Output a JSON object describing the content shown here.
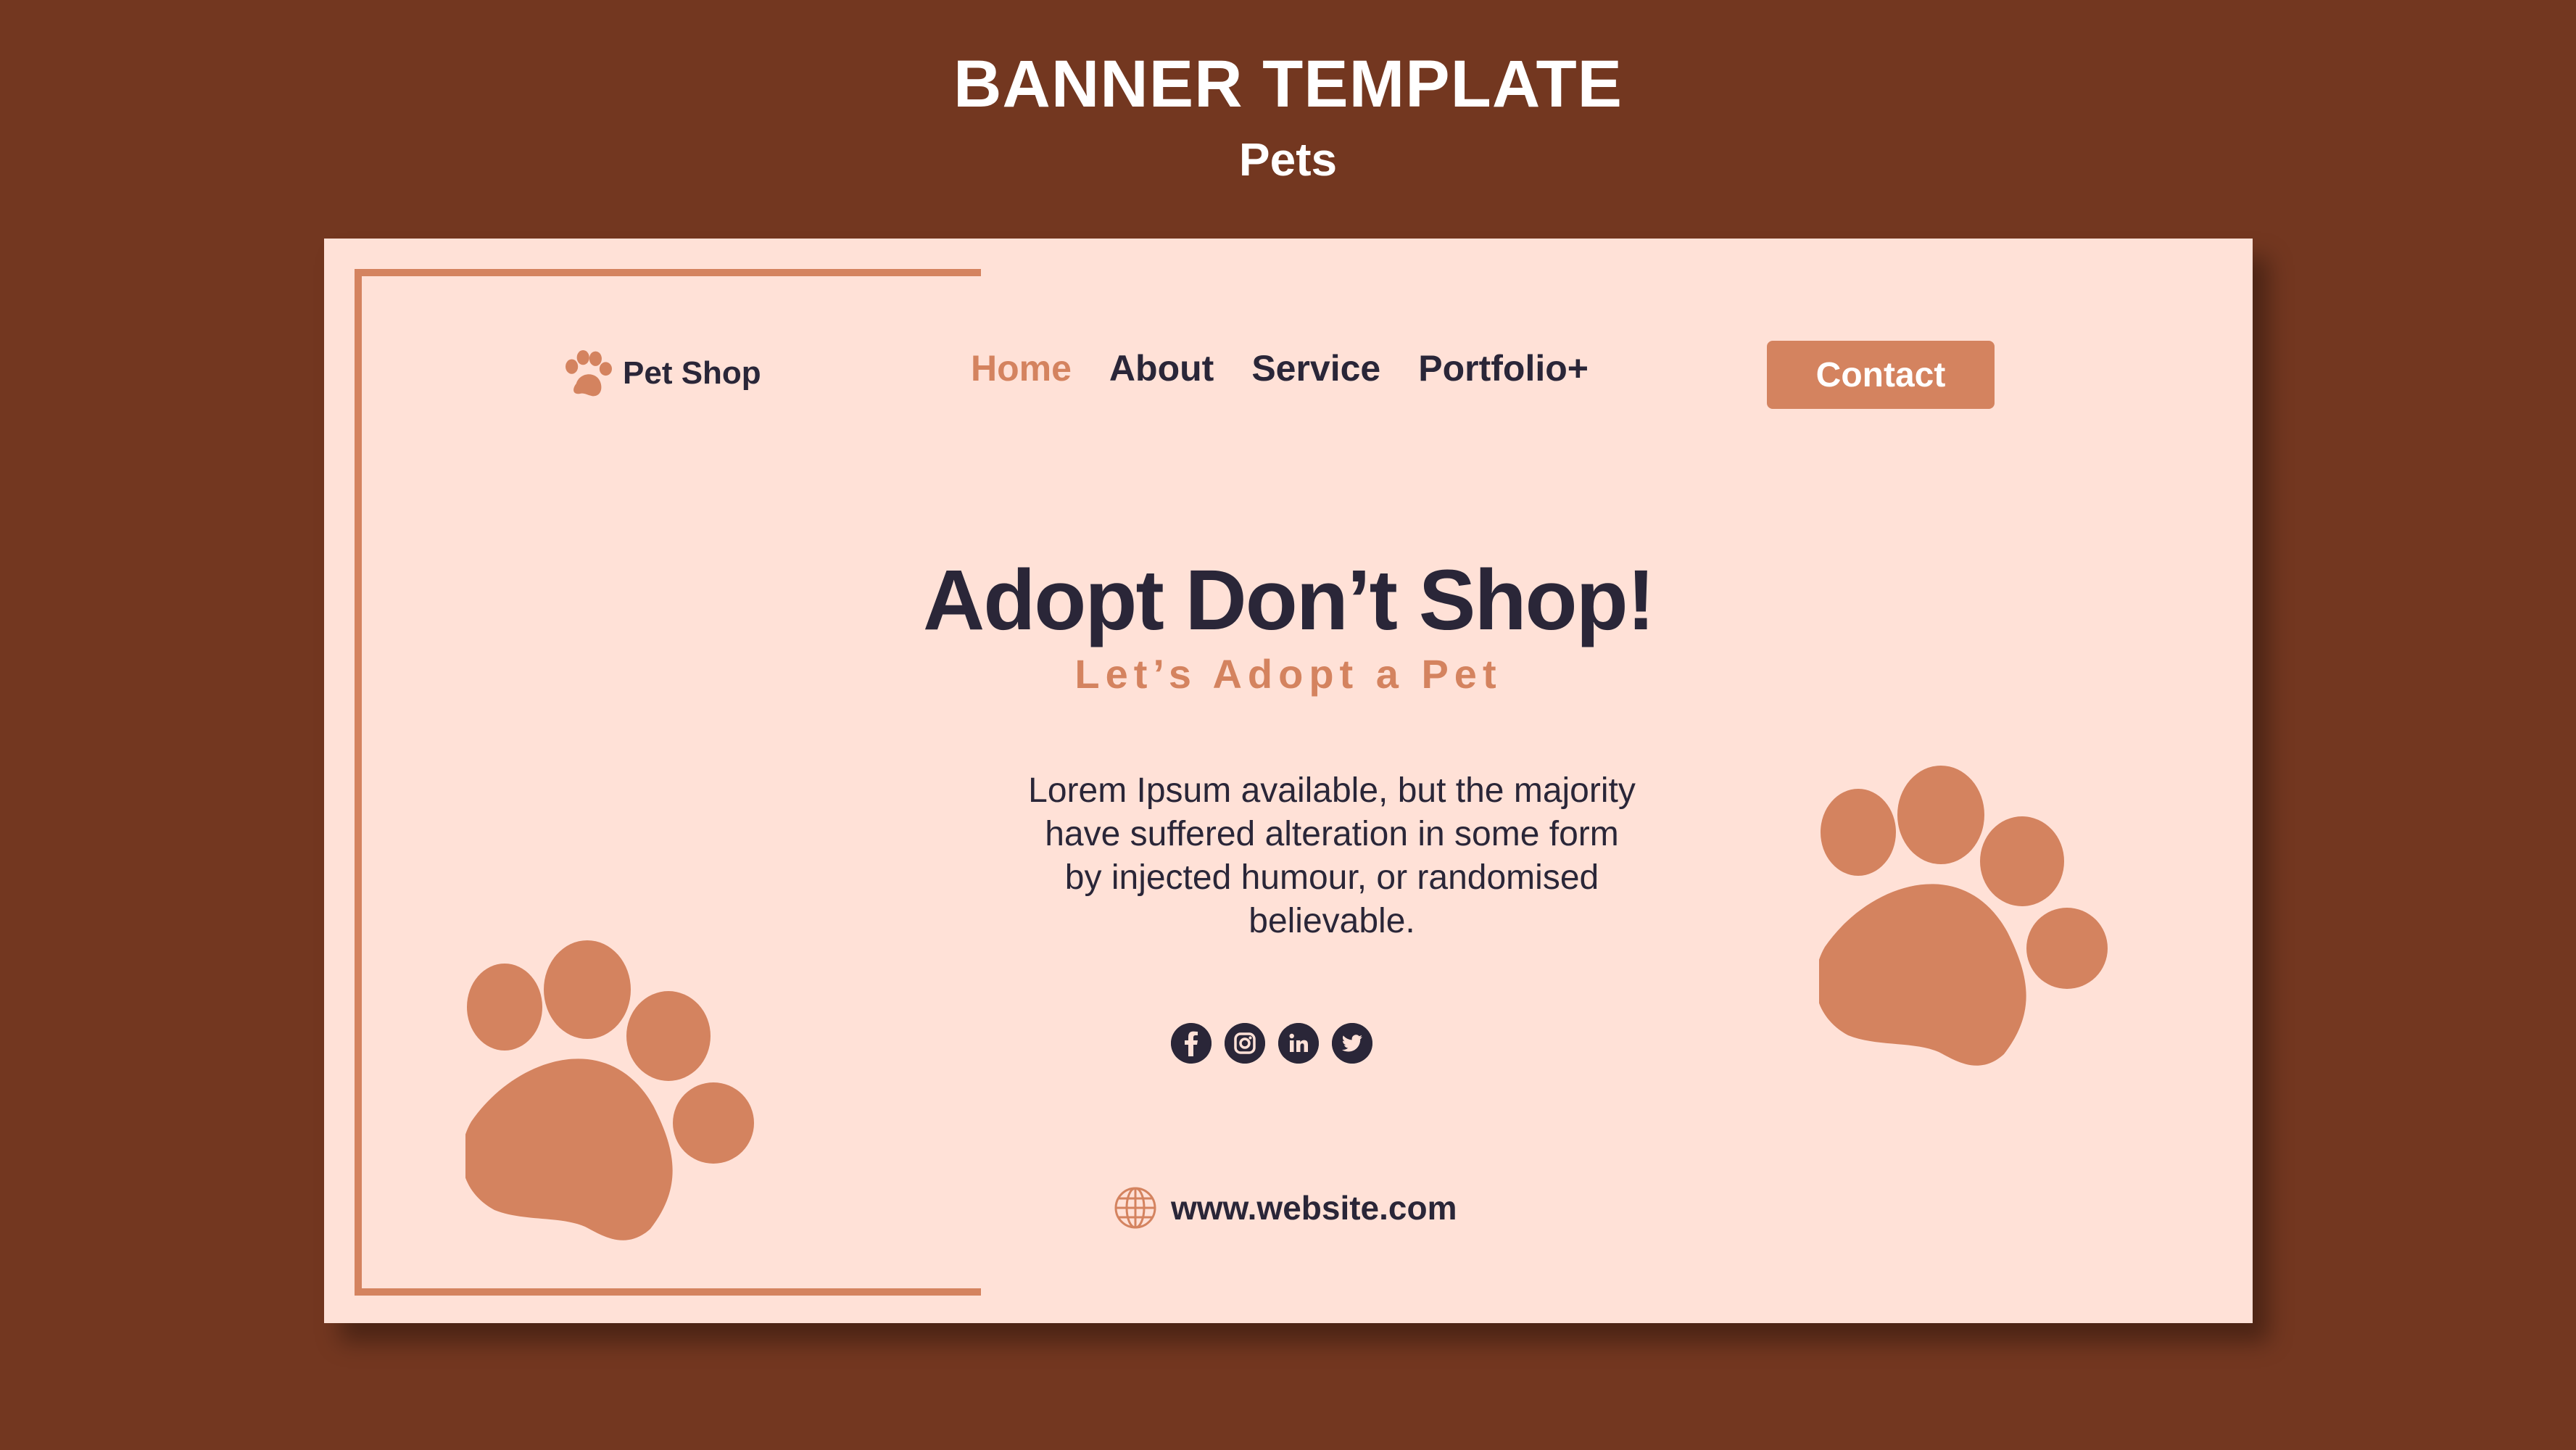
{
  "header": {
    "title": "BANNER TEMPLATE",
    "subtitle": "Pets"
  },
  "banner": {
    "logo": {
      "icon": "paw-icon",
      "text": "Pet Shop"
    },
    "nav": {
      "items": [
        {
          "label": "Home",
          "active": true
        },
        {
          "label": "About",
          "active": false
        },
        {
          "label": "Service",
          "active": false
        },
        {
          "label": "Portfolio+",
          "active": false
        }
      ]
    },
    "contact_label": "Contact",
    "headline": "Adopt Don’t Shop!",
    "tagline": "Let’s Adopt a Pet",
    "body_lines": [
      "Lorem Ipsum available, but the majority",
      "have suffered alteration in some form",
      "by injected humour, or randomised",
      "believable."
    ],
    "socials": [
      "facebook-icon",
      "instagram-icon",
      "linkedin-icon",
      "twitter-icon"
    ],
    "website": "www.website.com"
  },
  "colors": {
    "background": "#733720",
    "banner": "#ffe1d7",
    "accent": "#d4835f",
    "dark_text": "#2a2638",
    "white": "#ffffff"
  }
}
